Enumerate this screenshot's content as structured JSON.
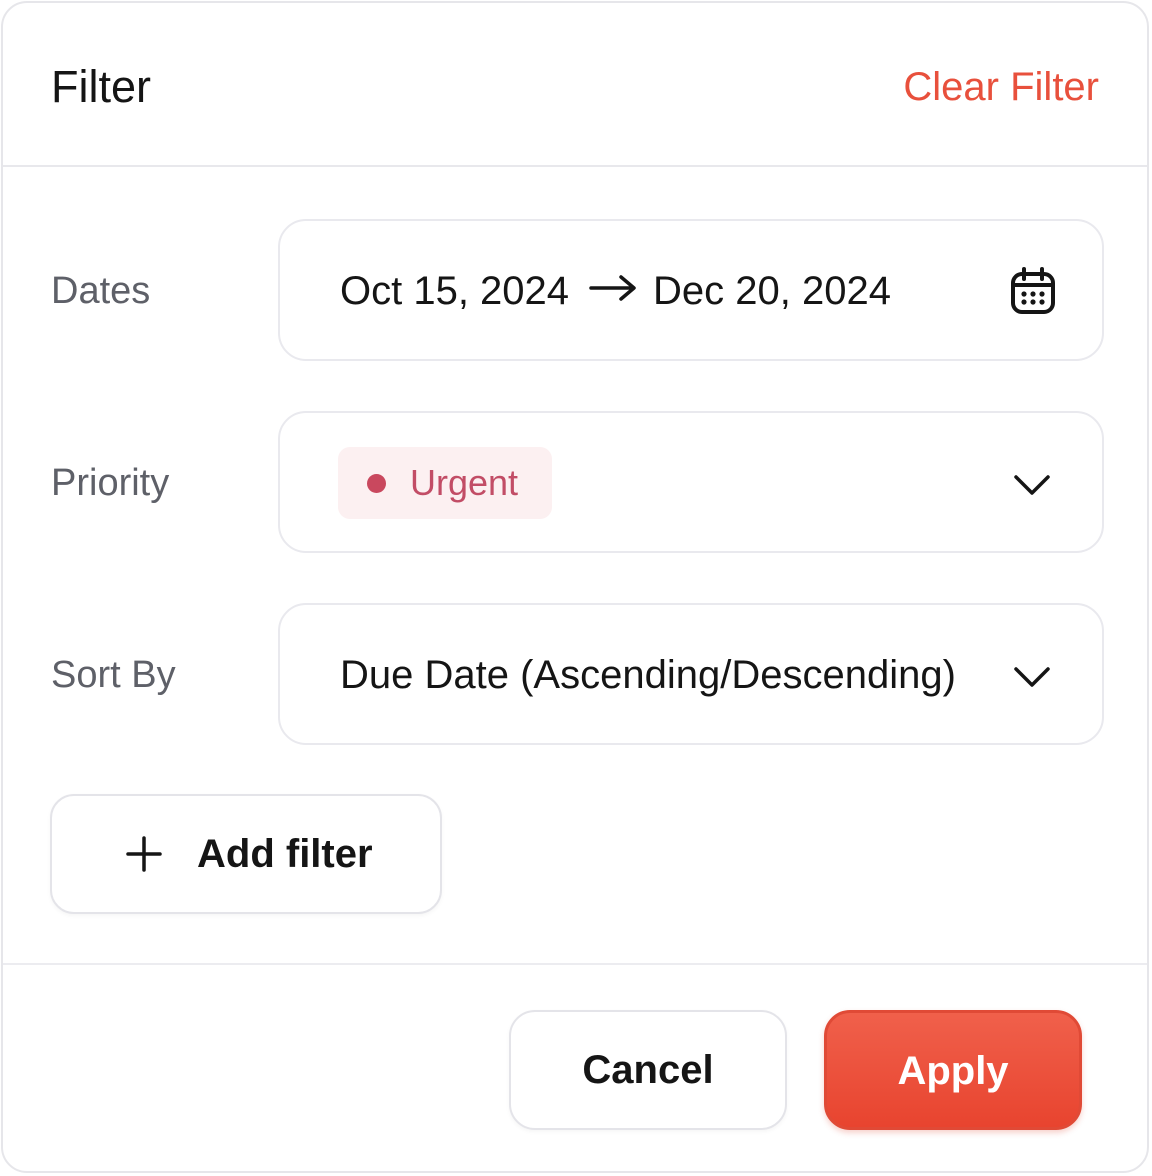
{
  "header": {
    "title": "Filter",
    "clear_label": "Clear Filter"
  },
  "dates": {
    "label": "Dates",
    "start": "Oct 15, 2024",
    "end": "Dec 20, 2024",
    "icon": "calendar-icon"
  },
  "priority": {
    "label": "Priority",
    "value": "Urgent",
    "badge_color": "#c24d66",
    "badge_background": "#fcf0f1",
    "icon": "chevron-down-icon"
  },
  "sort": {
    "label": "Sort By",
    "value": "Due Date (Ascending/Descending)",
    "icon": "chevron-down-icon"
  },
  "add_filter": {
    "label": "Add filter",
    "icon": "plus-icon"
  },
  "footer": {
    "cancel_label": "Cancel",
    "apply_label": "Apply"
  },
  "colors": {
    "accent": "#e8503c",
    "border": "#e9e9ee",
    "label_text": "#5e6068"
  }
}
